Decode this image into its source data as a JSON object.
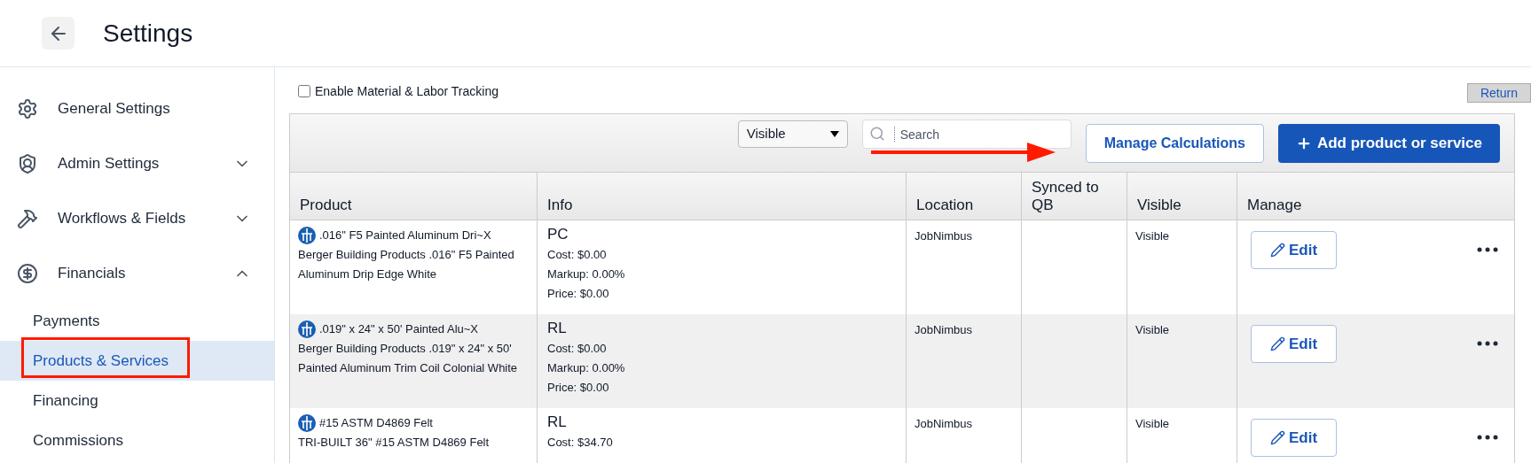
{
  "header": {
    "title": "Settings"
  },
  "sidebar": {
    "items": [
      {
        "label": "General Settings"
      },
      {
        "label": "Admin Settings",
        "expanded": false
      },
      {
        "label": "Workflows & Fields",
        "expanded": false
      },
      {
        "label": "Financials",
        "expanded": true,
        "children": [
          {
            "label": "Payments",
            "selected": false
          },
          {
            "label": "Products & Services",
            "selected": true
          },
          {
            "label": "Financing",
            "selected": false
          },
          {
            "label": "Commissions",
            "selected": false
          }
        ]
      }
    ]
  },
  "tracking": {
    "label": "Enable Material & Labor Tracking",
    "checked": false
  },
  "return_button": "Return",
  "toolbar": {
    "filter": "Visible",
    "search": {
      "placeholder": "Search"
    },
    "manage_button": "Manage Calculations",
    "add_button": "Add product or service"
  },
  "table": {
    "columns": [
      "Product",
      "Info",
      "Location",
      "Synced to QB",
      "Visible",
      "Manage"
    ],
    "rows": [
      {
        "title": ".016\" F5 Painted Aluminum Dri~X",
        "description": "Berger Building Products .016\" F5 Painted Aluminum Drip Edge White",
        "code": "PC",
        "cost": "Cost: $0.00",
        "markup": "Markup: 0.00%",
        "price": "Price: $0.00",
        "location": "JobNimbus",
        "visible": "Visible",
        "edit": "Edit"
      },
      {
        "title": ".019\" x 24\" x 50' Painted Alu~X",
        "description": "Berger Building Products .019\" x 24\" x 50' Painted Aluminum Trim Coil Colonial White",
        "code": "RL",
        "cost": "Cost: $0.00",
        "markup": "Markup: 0.00%",
        "price": "Price: $0.00",
        "location": "JobNimbus",
        "visible": "Visible",
        "edit": "Edit"
      },
      {
        "title": "#15 ASTM D4869 Felt",
        "description": "TRI-BUILT 36\" #15 ASTM D4869 Felt",
        "code": "RL",
        "cost": "Cost: $34.70",
        "location": "JobNimbus",
        "visible": "Visible",
        "edit": "Edit"
      }
    ]
  }
}
